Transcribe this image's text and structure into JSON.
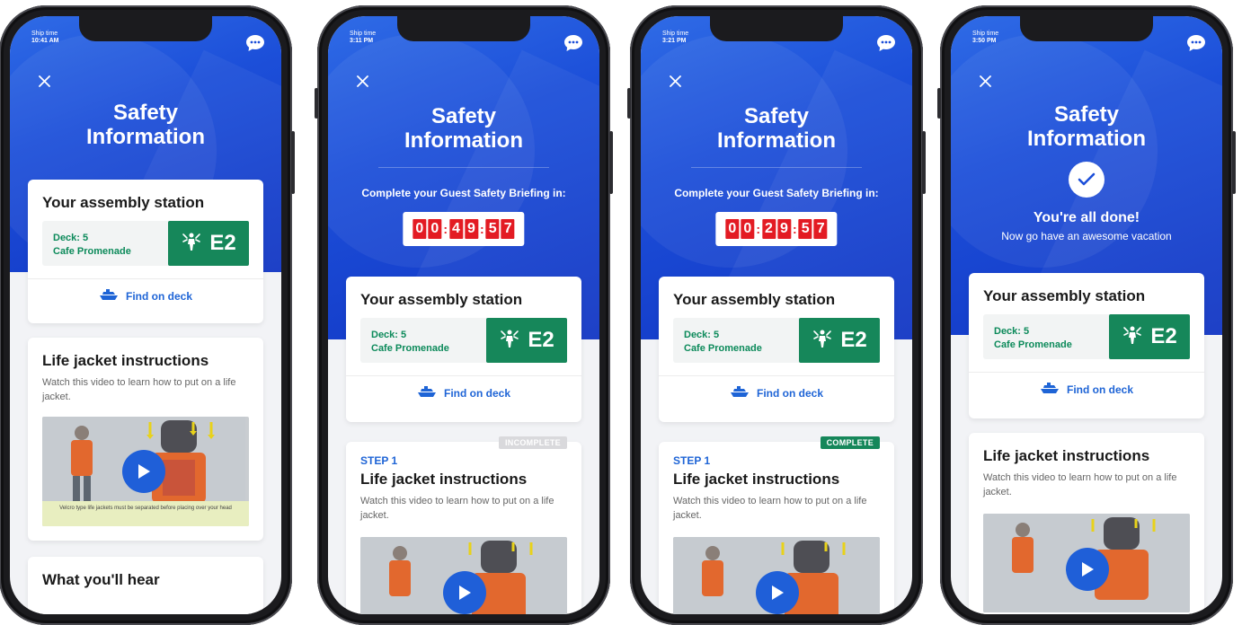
{
  "common": {
    "shiptime_label": "Ship time",
    "title_line1": "Safety",
    "title_line2": "Information",
    "assembly_title": "Your assembly station",
    "deck": "Deck: 5",
    "venue": "Cafe Promenade",
    "station_code": "E2",
    "find_on_deck": "Find on deck",
    "lifejacket_title": "Life jacket instructions",
    "lifejacket_desc": "Watch this video to learn how to put on a life jacket.",
    "video_caption": "Velcro type life jackets must be separated before placing over your head",
    "icons": [
      "chat-icon",
      "close-icon",
      "assembly-station-icon",
      "ship-icon",
      "play-icon",
      "checkmark-icon"
    ],
    "colors": {
      "hero_blue": "#1c4fd9",
      "station_green": "#16875a",
      "link_blue": "#1e64d6",
      "countdown_red": "#e31b23",
      "badge_gray": "#d9d9dc"
    }
  },
  "phones": [
    {
      "time": "10:41 AM",
      "next_section": "What you'll hear"
    },
    {
      "time": "3:11 PM",
      "countdown_label": "Complete your Guest Safety Briefing in:",
      "countdown": [
        "0",
        "0",
        "4",
        "9",
        "5",
        "7"
      ],
      "step": "STEP 1",
      "status": "INCOMPLETE"
    },
    {
      "time": "3:21 PM",
      "countdown_label": "Complete your Guest Safety Briefing in:",
      "countdown": [
        "0",
        "0",
        "2",
        "9",
        "5",
        "7"
      ],
      "step": "STEP 1",
      "status": "COMPLETE"
    },
    {
      "time": "3:50 PM",
      "done_title": "You're all done!",
      "done_subtitle": "Now go have an awesome vacation"
    }
  ]
}
